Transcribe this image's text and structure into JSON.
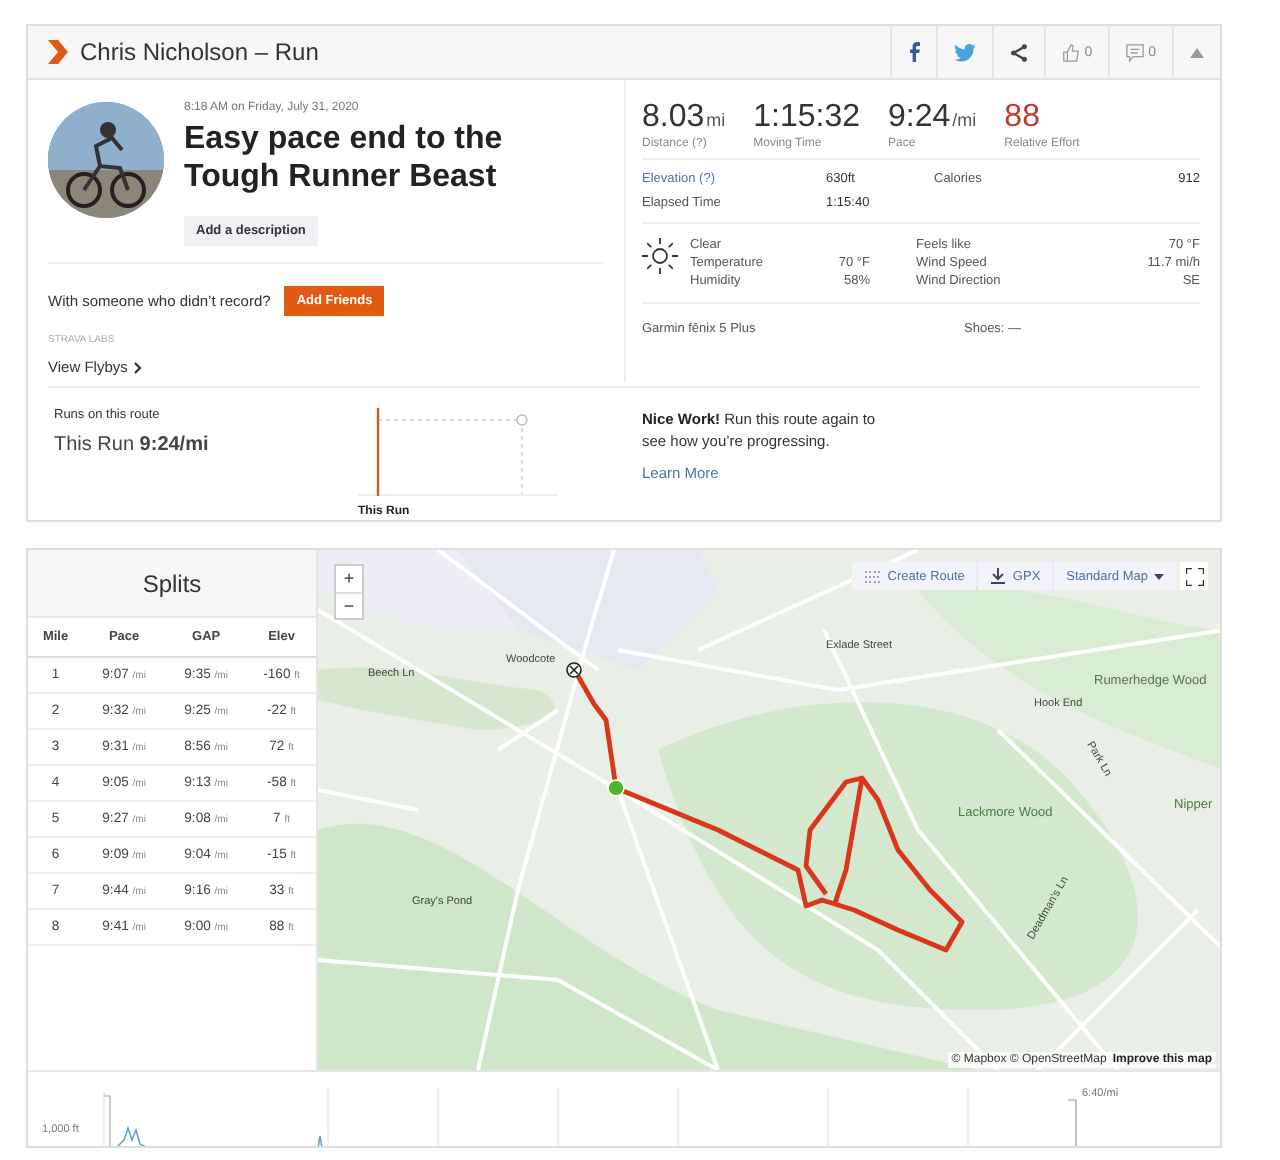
{
  "header": {
    "title": "Chris Nicholson – Run",
    "kudos": "0",
    "comments": "0"
  },
  "activity": {
    "datetime": "8:18 AM on Friday, July 31, 2020",
    "title": "Easy pace end to the Tough Runner Beast",
    "description_button": "Add a description",
    "friends_prompt": "With someone who didn’t record?",
    "friends_button": "Add Friends",
    "labs_label": "STRAVA LABS",
    "flybys_link": "View Flybys"
  },
  "stats": [
    {
      "value": "8.03",
      "unit": "mi",
      "label": "Distance (?)",
      "kind": "plain"
    },
    {
      "value": "1:15:32",
      "label": "Moving Time",
      "kind": "plain"
    },
    {
      "value": "9:24",
      "unit": "/mi",
      "label": "Pace",
      "kind": "plain"
    },
    {
      "value": "88",
      "label": "Relative Effort",
      "kind": "effort"
    }
  ],
  "details": [
    {
      "label": "Elevation (?)",
      "value": "630ft",
      "kind": "link"
    },
    {
      "label": "Calories",
      "value": "912",
      "kind": "plain"
    },
    {
      "label": "Elapsed Time",
      "value": "1:15:40",
      "kind": "plain"
    }
  ],
  "weather": {
    "condition": "Clear",
    "rows": [
      {
        "label": "Temperature",
        "value": "70 °F"
      },
      {
        "label": "Humidity",
        "value": "58%"
      },
      {
        "label": "Feels like",
        "value": "70 °F"
      },
      {
        "label": "Wind Speed",
        "value": "11.7 mi/h"
      },
      {
        "label": "Wind Direction",
        "value": "SE"
      }
    ]
  },
  "device": "Garmin fēnix 5 Plus",
  "shoes": "Shoes: —",
  "route": {
    "label": "Runs on this route",
    "this_run": "This Run **9:24/mi**",
    "axis_label": "This Run",
    "message": "**Nice Work!** Run this route again to see how you’re progressing.",
    "link": "Learn More"
  },
  "splits": {
    "title": "Splits",
    "columns": [
      "Mile",
      "Pace",
      "GAP",
      "Elev"
    ],
    "rows": [
      [
        "1",
        "9:07 /mi",
        "9:35 /mi",
        "-160 ft"
      ],
      [
        "2",
        "9:32 /mi",
        "9:25 /mi",
        "-22 ft"
      ],
      [
        "3",
        "9:31 /mi",
        "8:56 /mi",
        "72 ft"
      ],
      [
        "4",
        "9:05 /mi",
        "9:13 /mi",
        "-58 ft"
      ],
      [
        "5",
        "9:27 /mi",
        "9:08 /mi",
        "7 ft"
      ],
      [
        "6",
        "9:09 /mi",
        "9:04 /mi",
        "-15 ft"
      ],
      [
        "7",
        "9:44 /mi",
        "9:16 /mi",
        "33 ft"
      ],
      [
        "8",
        "9:41 /mi",
        "9:00 /mi",
        "88 ft"
      ]
    ]
  },
  "map": {
    "zoom_in": "+",
    "zoom_out": "−",
    "buttons": [
      "Create Route",
      "GPX",
      "Standard Map"
    ],
    "labels": [
      "Beech Ln",
      "Woodcote",
      "Gray's Pond",
      "Exlade Street",
      "Hook End",
      "Rumerhedge Wood",
      "Lackmore Wood",
      "Nipper",
      "Park Ln",
      "Deadman's Ln"
    ],
    "attribution": "© Mapbox © OpenStreetMap",
    "improve_link": "Improve this map"
  },
  "elevation": {
    "y_label": "1,000 ft",
    "pace_label": "6:40/mi"
  }
}
